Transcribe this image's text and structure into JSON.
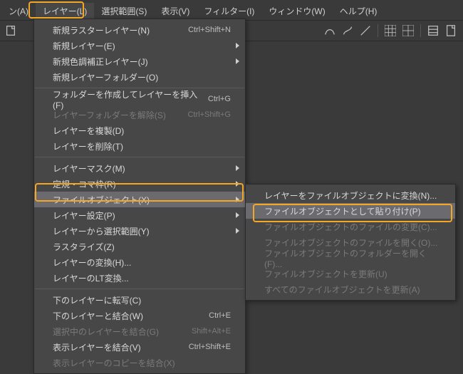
{
  "menubar": {
    "items": [
      {
        "label": "ン(A)"
      },
      {
        "label": "レイヤー(L)",
        "active": true
      },
      {
        "label": "選択範囲(S)"
      },
      {
        "label": "表示(V)"
      },
      {
        "label": "フィルター(I)"
      },
      {
        "label": "ウィンドウ(W)"
      },
      {
        "label": "ヘルプ(H)"
      }
    ]
  },
  "menu": {
    "items": [
      {
        "label": "新規ラスターレイヤー(N)",
        "shortcut": "Ctrl+Shift+N"
      },
      {
        "label": "新規レイヤー(E)",
        "submenu": true
      },
      {
        "label": "新規色調補正レイヤー(J)",
        "submenu": true
      },
      {
        "label": "新規レイヤーフォルダー(O)"
      },
      {
        "sep": true
      },
      {
        "label": "フォルダーを作成してレイヤーを挿入(F)",
        "shortcut": "Ctrl+G"
      },
      {
        "label": "レイヤーフォルダーを解除(S)",
        "shortcut": "Ctrl+Shift+G",
        "disabled": true
      },
      {
        "label": "レイヤーを複製(D)"
      },
      {
        "label": "レイヤーを削除(T)"
      },
      {
        "sep": true
      },
      {
        "label": "レイヤーマスク(M)",
        "submenu": true
      },
      {
        "label": "定規・コマ枠(R)",
        "submenu": true
      },
      {
        "label": "ファイルオブジェクト(X)",
        "submenu": true,
        "hovered": true
      },
      {
        "label": "レイヤー設定(P)",
        "submenu": true
      },
      {
        "label": "レイヤーから選択範囲(Y)",
        "submenu": true
      },
      {
        "label": "ラスタライズ(Z)"
      },
      {
        "label": "レイヤーの変換(H)..."
      },
      {
        "label": "レイヤーのLT変換..."
      },
      {
        "sep": true
      },
      {
        "label": "下のレイヤーに転写(C)"
      },
      {
        "label": "下のレイヤーと結合(W)",
        "shortcut": "Ctrl+E"
      },
      {
        "label": "選択中のレイヤーを結合(G)",
        "shortcut": "Shift+Alt+E",
        "disabled": true
      },
      {
        "label": "表示レイヤーを結合(V)",
        "shortcut": "Ctrl+Shift+E"
      },
      {
        "label": "表示レイヤーのコピーを結合(X)",
        "disabled": true
      }
    ]
  },
  "submenu": {
    "items": [
      {
        "label": "レイヤーをファイルオブジェクトに変換(N)..."
      },
      {
        "label": "ファイルオブジェクトとして貼り付け(P)",
        "hovered": true
      },
      {
        "label": "ファイルオブジェクトのファイルの変更(C)...",
        "disabled": true
      },
      {
        "label": "ファイルオブジェクトのファイルを開く(O)...",
        "disabled": true
      },
      {
        "label": "ファイルオブジェクトのフォルダーを開く(F)...",
        "disabled": true
      },
      {
        "label": "ファイルオブジェクトを更新(U)",
        "disabled": true
      },
      {
        "label": "すべてのファイルオブジェクトを更新(A)",
        "disabled": true
      }
    ]
  }
}
